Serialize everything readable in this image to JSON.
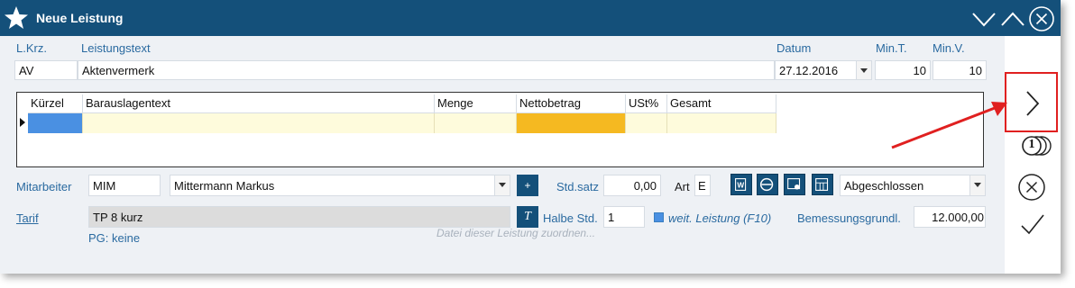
{
  "window": {
    "title": "Neue Leistung"
  },
  "header_labels": {
    "lkrz": "L.Krz.",
    "leistungstext": "Leistungstext",
    "datum": "Datum",
    "mint": "Min.T.",
    "minv": "Min.V."
  },
  "fields": {
    "lkrz": "AV",
    "leistungstext": "Aktenvermerk",
    "datum": "27.12.2016",
    "mint": "10",
    "minv": "10"
  },
  "grid": {
    "columns": [
      "Kürzel",
      "Barauslagentext",
      "Menge",
      "Nettobetrag",
      "USt%",
      "Gesamt"
    ],
    "rows": [
      [
        "",
        "",
        "",
        "",
        "",
        ""
      ]
    ]
  },
  "mitarbeiter": {
    "label": "Mitarbeiter",
    "code": "MIM",
    "name": "Mittermann Markus",
    "add_label": "+",
    "stdsatz_label": "Std.satz",
    "stdsatz": "0,00",
    "art_label": "Art",
    "art": "E",
    "status": "Abgeschlossen"
  },
  "tarif": {
    "label": "Tarif",
    "value": "TP 8 kurz",
    "t_label": "T",
    "halbe_label": "Halbe Std.",
    "halbe": "1",
    "weit_label": "weit. Leistung (F10)",
    "bemessung_label": "Bemessungsgrundl.",
    "bemessung": "12.000,00",
    "pg": "PG: keine"
  },
  "footer": {
    "hint": "Datei dieser Leistung zuordnen..."
  },
  "side": {
    "counter": "1"
  },
  "colors": {
    "titlebar": "#14507a",
    "accent": "#2a6aa0",
    "nettobetrag": "#f5b921",
    "kuerzel": "#4a90e2",
    "highlight": "#e02020"
  }
}
